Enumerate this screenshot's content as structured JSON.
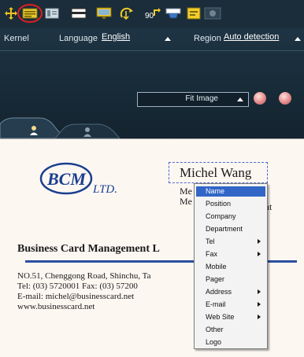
{
  "toolbar": {
    "rotate_label": "90",
    "icons": [
      "move-icon",
      "card-scan-icon",
      "card-list-icon",
      "white-card-icon",
      "screen-icon",
      "recycle-icon",
      "rotate-90-icon",
      "tray-icon",
      "export-icon",
      "record-icon"
    ],
    "accent": "#e01f1f"
  },
  "panel": {
    "kernel_label": "Kernel",
    "language_label": "Language",
    "language_value": "English",
    "region_label": "Region",
    "region_value": "Auto detection",
    "fit_value": "Fit Image"
  },
  "card": {
    "logo_text": "BCM",
    "logo_suffix": "LTD.",
    "name": "Michel Wang",
    "fragment_1": "Me",
    "fragment_2": "Me",
    "fragment_3": "nt",
    "company": "Business Card Management  L",
    "address_lines": [
      "NO.51, Chenggong Road, Shinchu, Ta",
      "Tel: (03) 5720001      Fax: (03) 57200",
      "E-mail: michel@businesscard.net",
      "www.businesscard.net"
    ],
    "accent": "#2c4f9e"
  },
  "context_menu": {
    "items": [
      {
        "label": "Name",
        "submenu": false,
        "selected": true
      },
      {
        "label": "Position",
        "submenu": false,
        "selected": false
      },
      {
        "label": "Company",
        "submenu": false,
        "selected": false
      },
      {
        "label": "Department",
        "submenu": false,
        "selected": false
      },
      {
        "label": "Tel",
        "submenu": true,
        "selected": false
      },
      {
        "label": "Fax",
        "submenu": true,
        "selected": false
      },
      {
        "label": "Mobile",
        "submenu": false,
        "selected": false
      },
      {
        "label": "Pager",
        "submenu": false,
        "selected": false
      },
      {
        "label": "Address",
        "submenu": true,
        "selected": false
      },
      {
        "label": "E-mail",
        "submenu": true,
        "selected": false
      },
      {
        "label": "Web Site",
        "submenu": true,
        "selected": false
      },
      {
        "label": "Other",
        "submenu": false,
        "selected": false
      },
      {
        "label": "Logo",
        "submenu": false,
        "selected": false
      }
    ],
    "selected_color": "#3166c7"
  }
}
